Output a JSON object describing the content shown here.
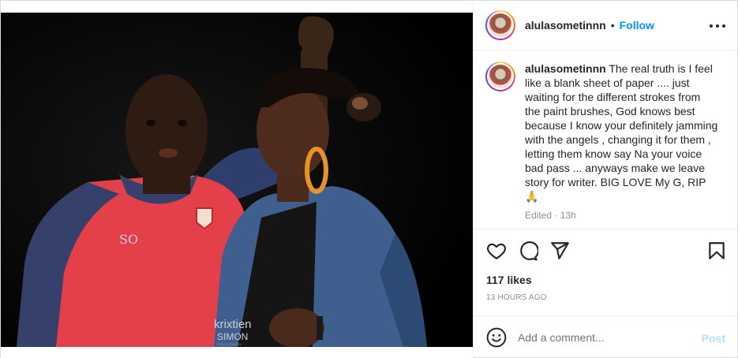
{
  "header": {
    "username": "alulasometinnn",
    "separator": "•",
    "follow_label": "Follow",
    "more_icon": "more-horizontal-icon"
  },
  "caption": {
    "username": "alulasometinnn",
    "text": "The real truth is I feel like a blank sheet of paper .... just waiting for the different strokes from the paint brushes, God knows best because I know your definitely jamming with the angels , changing it for them , letting them know say Na your voice bad pass ... anyways make we leave story for writer. BIG LOVE My G, RIP🙏",
    "meta": "Edited · 13h"
  },
  "photo": {
    "watermark_line1": "krixtien",
    "watermark_line2": "SIMON",
    "watermark_line3": "PHOTOGRAPHY",
    "shirt_text": "SO"
  },
  "actions": {
    "like_icon": "heart-icon",
    "comment_icon": "comment-icon",
    "share_icon": "send-icon",
    "save_icon": "bookmark-icon",
    "likes_text": "117 likes",
    "time_text": "13 HOURS AGO"
  },
  "add_comment": {
    "emoji_icon": "emoji-icon",
    "placeholder": "Add a comment...",
    "post_label": "Post"
  },
  "colors": {
    "accent": "#0095f6",
    "post_disabled": "#b2dffc",
    "muted": "#8e8e8e"
  }
}
